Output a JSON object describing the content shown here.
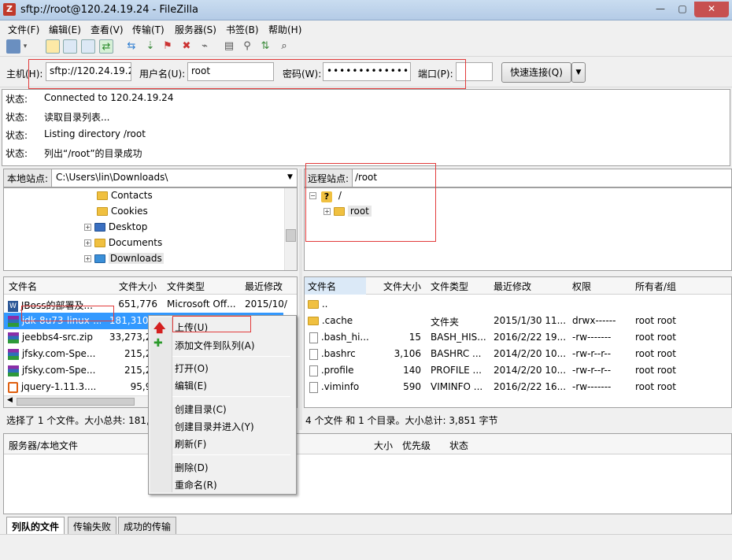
{
  "window": {
    "title": "sftp://root@120.24.19.24 - FileZilla",
    "app_icon_letter": "Z",
    "minimize": "—",
    "maximize": "▢",
    "close": "✕"
  },
  "menu": [
    "文件(F)",
    "编辑(E)",
    "查看(V)",
    "传输(T)",
    "服务器(S)",
    "书签(B)",
    "帮助(H)"
  ],
  "connect": {
    "host_label": "主机(H):",
    "host_value": "sftp://120.24.19.24",
    "user_label": "用户名(U):",
    "user_value": "root",
    "pass_label": "密码(W):",
    "pass_value": "•••••••••••••",
    "port_label": "端口(P):",
    "port_value": "",
    "quickconnect_label": "快速连接(Q)"
  },
  "log": [
    {
      "key": "状态:",
      "text": "Connected to 120.24.19.24"
    },
    {
      "key": "状态:",
      "text": "读取目录列表..."
    },
    {
      "key": "状态:",
      "text": "Listing directory /root"
    },
    {
      "key": "状态:",
      "text": "列出“/root”的目录成功"
    }
  ],
  "local": {
    "site_label": "本地站点:",
    "path": "C:\\Users\\lin\\Downloads\\",
    "tree": [
      "Contacts",
      "Cookies",
      "Desktop",
      "Documents",
      "Downloads"
    ],
    "headers": [
      "文件名",
      "文件大小",
      "文件类型",
      "最近修改"
    ],
    "files": [
      {
        "name": "JBoss的部署及...",
        "size": "651,776",
        "type": "Microsoft Off...",
        "modified": "2015/10/"
      },
      {
        "name": "jdk-8u73-linux-...",
        "size": "181,310,7",
        "type": "",
        "modified": ""
      },
      {
        "name": "jeebbs4-src.zip",
        "size": "33,273,27",
        "type": "",
        "modified": ""
      },
      {
        "name": "jfsky.com-Spe...",
        "size": "215,27",
        "type": "",
        "modified": ""
      },
      {
        "name": "jfsky.com-Spe...",
        "size": "215,27",
        "type": "",
        "modified": ""
      },
      {
        "name": "jquery-1.11.3....",
        "size": "95,95",
        "type": "",
        "modified": ""
      }
    ],
    "status": "选择了 1 个文件。大小总共: 181,3"
  },
  "remote": {
    "site_label": "远程站点:",
    "path": "/root",
    "tree_root": "/",
    "tree_child": "root",
    "headers": [
      "文件名",
      "文件大小",
      "文件类型",
      "最近修改",
      "权限",
      "所有者/组"
    ],
    "files": [
      {
        "name": "..",
        "size": "",
        "type": "",
        "modified": "",
        "perm": "",
        "owner": ""
      },
      {
        "name": ".cache",
        "size": "",
        "type": "文件夹",
        "modified": "2015/1/30 11...",
        "perm": "drwx------",
        "owner": "root root"
      },
      {
        "name": ".bash_hi...",
        "size": "15",
        "type": "BASH_HIS...",
        "modified": "2016/2/22 19...",
        "perm": "-rw-------",
        "owner": "root root"
      },
      {
        "name": ".bashrc",
        "size": "3,106",
        "type": "BASHRC ...",
        "modified": "2014/2/20 10...",
        "perm": "-rw-r--r--",
        "owner": "root root"
      },
      {
        "name": ".profile",
        "size": "140",
        "type": "PROFILE ...",
        "modified": "2014/2/20 10...",
        "perm": "-rw-r--r--",
        "owner": "root root"
      },
      {
        "name": ".viminfo",
        "size": "590",
        "type": "VIMINFO ...",
        "modified": "2016/2/22 16...",
        "perm": "-rw-------",
        "owner": "root root"
      }
    ],
    "status": "4 个文件 和 1 个目录。大小总计: 3,851 字节"
  },
  "context_menu": {
    "upload": "上传(U)",
    "add_queue": "添加文件到队列(A)",
    "open": "打开(O)",
    "edit": "编辑(E)",
    "mkdir": "创建目录(C)",
    "mkdir_enter": "创建目录并进入(Y)",
    "refresh": "刷新(F)",
    "delete": "删除(D)",
    "rename": "重命名(R)"
  },
  "queue": {
    "headers": [
      "服务器/本地文件",
      "大小",
      "优先级",
      "状态"
    ]
  },
  "tabs": [
    "列队的文件",
    "传输失败",
    "成功的传输"
  ],
  "colors": {
    "selection": "#3399ff",
    "highlight_box": "#e23b3b",
    "title_bg": "#b9d1ea"
  }
}
